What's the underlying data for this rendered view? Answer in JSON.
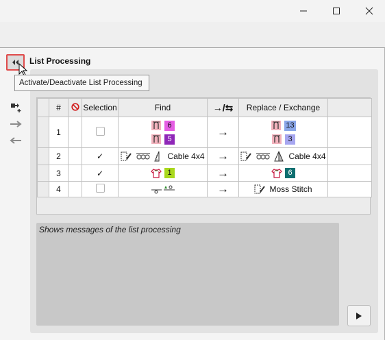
{
  "window": {
    "minimize_icon": "minimize-icon",
    "maximize_icon": "maximize-icon",
    "close_icon": "close-icon"
  },
  "panel": {
    "title": "List Processing",
    "collapse_icon": "double-chevron-left-icon",
    "tooltip": "Activate/Deactivate List Processing",
    "highlight_color": "#e04b4b"
  },
  "side_toolbar": [
    {
      "icon": "add-row-icon"
    },
    {
      "icon": "arrow-right-icon"
    },
    {
      "icon": "arrow-left-icon"
    }
  ],
  "table": {
    "headers": {
      "number": "#",
      "exclude_icon": "prohibited-icon",
      "selection": "Selection",
      "find": "Find",
      "direction": "→/⇆",
      "replace": "Replace / Exchange"
    },
    "rows": [
      {
        "number": "1",
        "selected": false,
        "find": [
          {
            "icon": "yarn-carrier-icon",
            "badge": "6",
            "color": "#e55ce3"
          },
          {
            "icon": "yarn-carrier-icon",
            "badge": "5",
            "color": "#8f27b8"
          }
        ],
        "replace": [
          {
            "icon": "yarn-carrier-icon",
            "badge": "13",
            "color": "#8aa6e8"
          },
          {
            "icon": "yarn-carrier-icon",
            "badge": "3",
            "color": "#a6a6f0"
          }
        ]
      },
      {
        "number": "2",
        "selected": true,
        "selected_mark": "✓",
        "find_text": "Cable 4x4",
        "replace_text": "Cable 4x4"
      },
      {
        "number": "3",
        "selected": true,
        "selected_mark": "✓",
        "find_badge": "1",
        "find_color": "#a9d81d",
        "replace_badge": "6",
        "replace_color": "#0f6f70"
      },
      {
        "number": "4",
        "selected": false,
        "replace_text": "Moss Stitch"
      }
    ],
    "arrow": "→"
  },
  "messages": {
    "text": "Shows messages of the list processing"
  },
  "run_button_icon": "play-icon"
}
